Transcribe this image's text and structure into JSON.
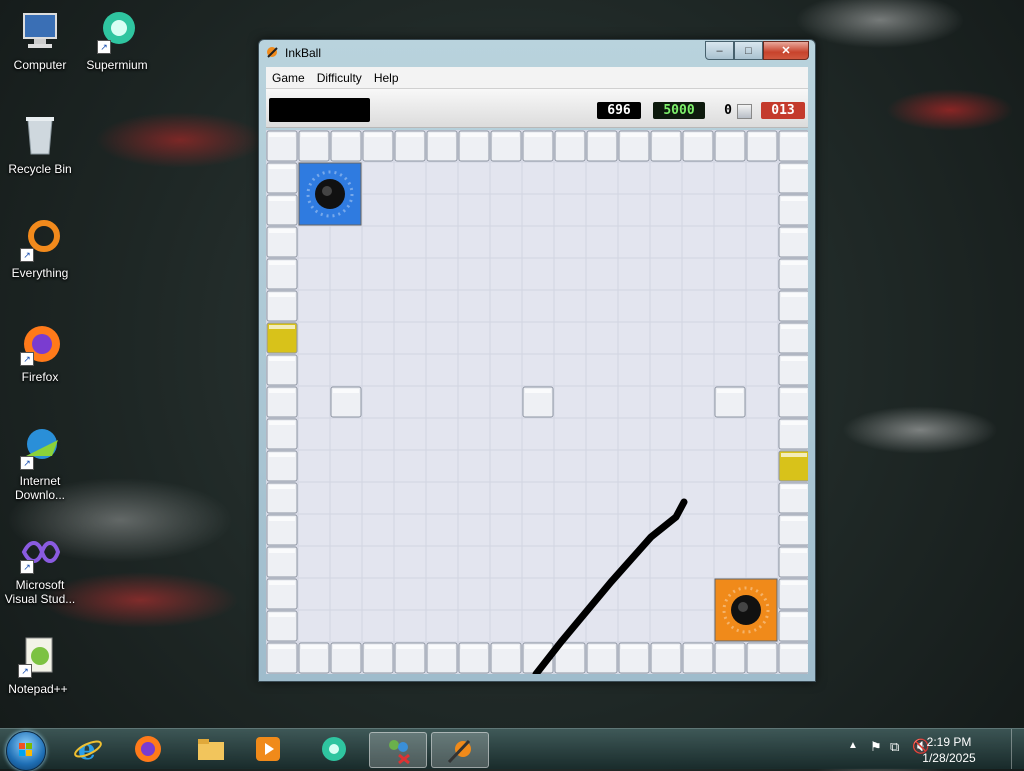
{
  "desktop": {
    "icons": [
      {
        "label": "Computer"
      },
      {
        "label": "Supermium"
      },
      {
        "label": "Recycle Bin"
      },
      {
        "label": "Everything"
      },
      {
        "label": "Firefox"
      },
      {
        "label": "Internet Downlo..."
      },
      {
        "label": "Microsoft Visual Stud..."
      },
      {
        "label": "Notepad++"
      }
    ]
  },
  "window": {
    "title": "InkBall",
    "menu": [
      "Game",
      "Difficulty",
      "Help"
    ],
    "caption_buttons": {
      "minimize": "–",
      "maximize": "□",
      "close": "✕"
    }
  },
  "scoreboard": {
    "time": "696",
    "score": "5000",
    "balls_collected": "0",
    "balls_remaining": "013"
  },
  "colors": {
    "blue_hole": "#2f7be0",
    "orange_hole": "#f08a1a",
    "yellow_block": "#d8c21a",
    "ink_line": "#000000",
    "score_green": "#7df06a",
    "remaining_red": "#e03a2a"
  },
  "taskbar": {
    "pinned": [
      "internet-explorer",
      "firefox",
      "file-explorer",
      "media-player",
      "supermium",
      "network-app",
      "inkball"
    ],
    "clock_time": "2:19 PM",
    "clock_date": "1/28/2025"
  }
}
